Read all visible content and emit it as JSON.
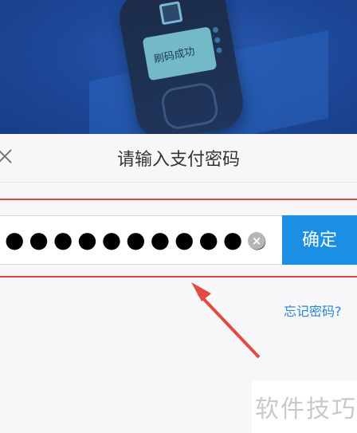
{
  "hero": {
    "device_screen_text": "刷码成功"
  },
  "dialog": {
    "title": "请输入支付密码",
    "password_masked": "●●●●●●●●●●●",
    "confirm_label": "确定",
    "forgot_label": "忘记密码?"
  },
  "watermark": "软件技巧",
  "colors": {
    "accent": "#1b8fe3",
    "highlight": "#d54a4a",
    "link": "#2a86d2"
  }
}
